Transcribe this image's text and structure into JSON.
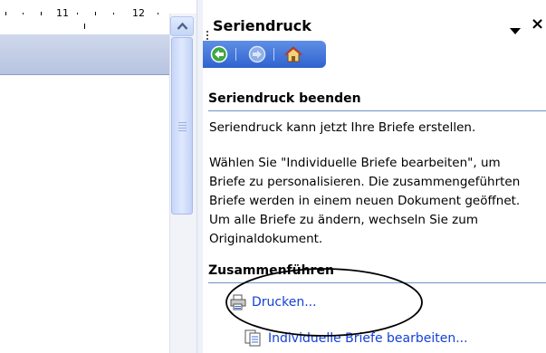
{
  "ruler": {
    "mark_11": "11",
    "mark_12": "12"
  },
  "task_pane": {
    "title": "Seriendruck",
    "close_glyph": "×",
    "nav_icons": [
      "back-icon",
      "forward-icon",
      "home-icon"
    ]
  },
  "finish_section": {
    "heading": "Seriendruck beenden",
    "para1": "Seriendruck kann jetzt Ihre Briefe erstellen.",
    "para2": "Wählen Sie \"Individuelle Briefe bearbeiten\", um Briefe zu personalisieren. Die zusammengeführten Briefe werden in einem neuen Dokument geöffnet. Um alle Briefe zu ändern, wechseln Sie zum Originaldokument."
  },
  "merge_section": {
    "heading": "Zusammenführen",
    "print_label": "Drucken...",
    "edit_label": "Individuelle Briefe bearbeiten..."
  },
  "colors": {
    "link": "#1540d8",
    "nav_bar": "#3a6fd8",
    "annotation": "#000000"
  }
}
